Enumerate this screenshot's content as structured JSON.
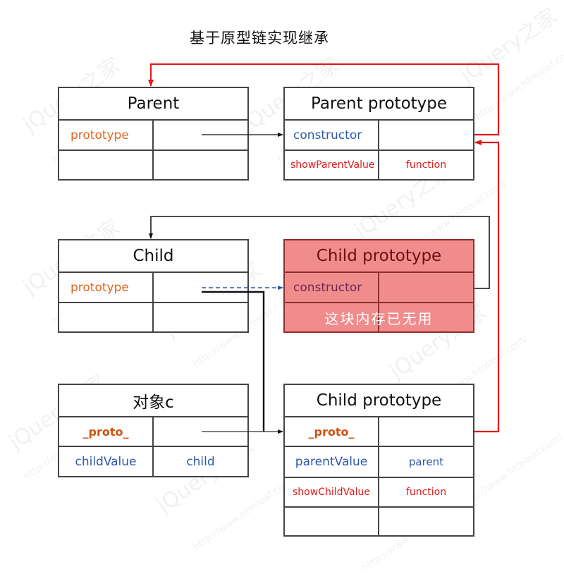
{
  "title": "基于原型链实现继承",
  "colors": {
    "red_link": "#e01a1a",
    "black_link": "#111111",
    "blue_dashed_link": "#2d58a8",
    "dead_fill": "#f08c8c",
    "dead_border": "#8e2e2e"
  },
  "boxes": {
    "parent": {
      "title": "Parent",
      "rows": [
        {
          "key": "prototype",
          "value": ""
        },
        {
          "key": "",
          "value": ""
        }
      ]
    },
    "parent_prototype": {
      "title": "Parent prototype",
      "rows": [
        {
          "key": "constructor",
          "value": ""
        },
        {
          "key": "showParentValue",
          "value": "function"
        }
      ]
    },
    "child": {
      "title": "Child",
      "rows": [
        {
          "key": "prototype",
          "value": ""
        },
        {
          "key": "",
          "value": ""
        }
      ]
    },
    "child_prototype_old": {
      "title": "Child prototype",
      "rows": [
        {
          "key": "constructor",
          "value": ""
        },
        {
          "key": "",
          "value": ""
        }
      ],
      "note": "这块内存已无用"
    },
    "object_c": {
      "title": "对象c",
      "rows": [
        {
          "key": "_proto_",
          "value": ""
        },
        {
          "key": "childValue",
          "value": "child"
        }
      ]
    },
    "child_prototype_new": {
      "title": "Child prototype",
      "rows": [
        {
          "key": "_proto_",
          "value": ""
        },
        {
          "key": "parentValue",
          "value": "parent"
        },
        {
          "key": "showChildValue",
          "value": "function"
        },
        {
          "key": "",
          "value": ""
        }
      ]
    }
  },
  "links": [
    {
      "from": "parent.prototype",
      "to": "parent_prototype",
      "style": "solid-black"
    },
    {
      "from": "parent_prototype.constructor",
      "to": "parent",
      "style": "solid-red"
    },
    {
      "from": "child.prototype",
      "to": "child_prototype_old",
      "style": "dashed-blue"
    },
    {
      "from": "child.prototype",
      "to": "child_prototype_new",
      "style": "solid-black-thick"
    },
    {
      "from": "child_prototype_old.constructor",
      "to": "child",
      "style": "solid-black"
    },
    {
      "from": "object_c._proto_",
      "to": "child_prototype_new",
      "style": "solid-black"
    },
    {
      "from": "child_prototype_new._proto_",
      "to": "parent_prototype",
      "style": "solid-red"
    }
  ],
  "watermark": {
    "brand": "jQuery之家",
    "url": "http://www.htmleaf.com/"
  }
}
